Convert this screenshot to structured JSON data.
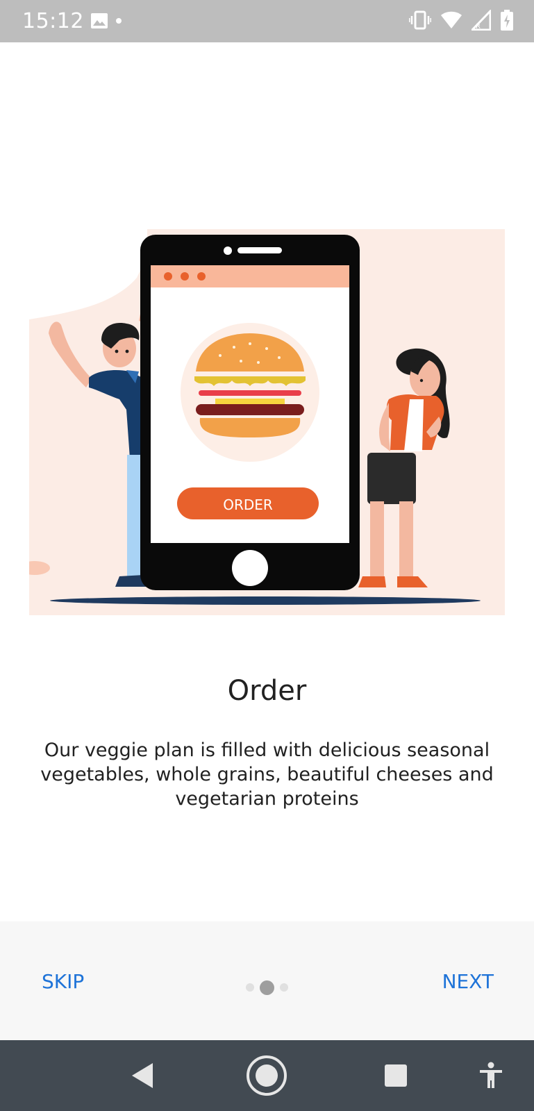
{
  "status_bar": {
    "time": "15:12",
    "icons": [
      "image-icon",
      "dot-icon",
      "vibrate-icon",
      "wifi-icon",
      "signal-icon",
      "battery-icon"
    ]
  },
  "illustration": {
    "order_button_label": "ORDER"
  },
  "slide": {
    "title": "Order",
    "description": "Our veggie plan is filled with delicious seasonal vegetables, whole grains, beautiful cheeses and vegetarian proteins"
  },
  "controls": {
    "skip_label": "SKIP",
    "next_label": "NEXT",
    "page_count": 3,
    "active_page": 2
  },
  "nav_bar": {
    "icons": [
      "back-icon",
      "home-icon",
      "recents-icon",
      "accessibility-icon"
    ]
  },
  "colors": {
    "accent": "#1e73d8",
    "status_bar": "#bdbdbd",
    "nav_bar": "#424a52",
    "brand_orange": "#e8612c"
  }
}
